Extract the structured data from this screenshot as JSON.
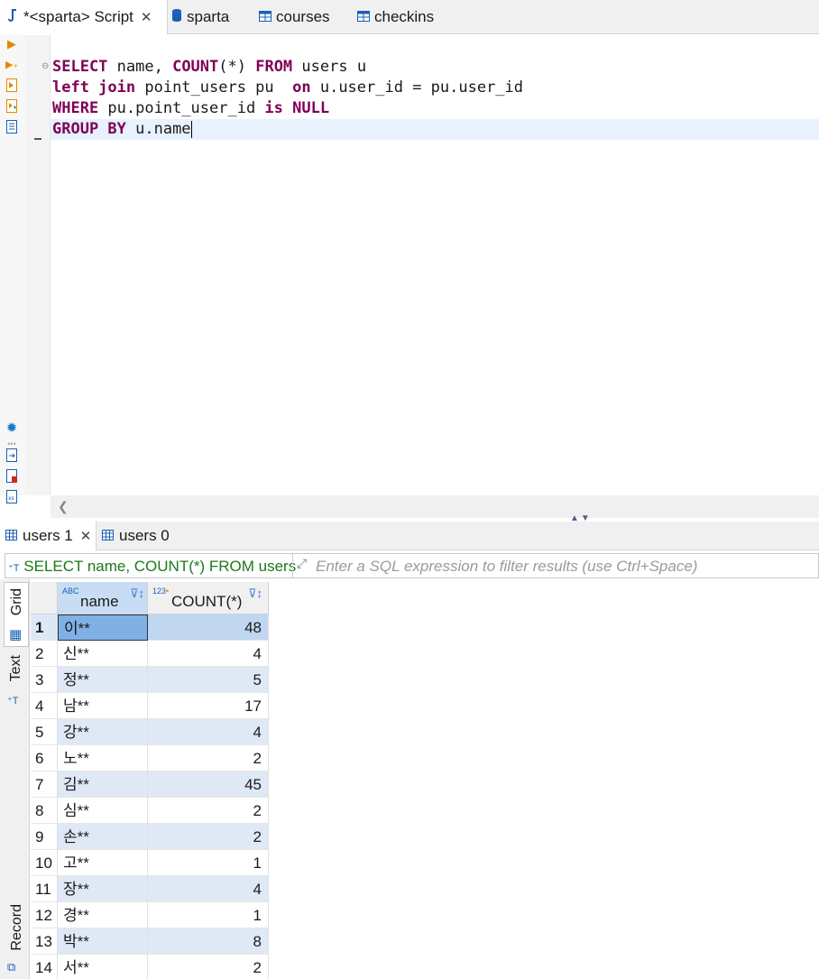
{
  "editor_tabs": [
    {
      "label": "*<sparta> Script",
      "icon": "sql-script-icon",
      "active": true
    },
    {
      "label": "sparta",
      "icon": "database-icon"
    },
    {
      "label": "courses",
      "icon": "table-icon"
    },
    {
      "label": "checkins",
      "icon": "table-icon"
    }
  ],
  "editor": {
    "lines": [
      [
        {
          "t": "SELECT",
          "k": true
        },
        {
          "t": " name, "
        },
        {
          "t": "COUNT",
          "k": true
        },
        {
          "t": "(*) "
        },
        {
          "t": "FROM",
          "k": true
        },
        {
          "t": " users u"
        }
      ],
      [
        {
          "t": "left join",
          "k": true
        },
        {
          "t": " point_users pu  "
        },
        {
          "t": "on",
          "k": true
        },
        {
          "t": " u.user_id = pu.user_id"
        }
      ],
      [
        {
          "t": "WHERE",
          "k": true
        },
        {
          "t": " pu.point_user_id "
        },
        {
          "t": "is",
          "k": true
        },
        {
          "t": " "
        },
        {
          "t": "NULL",
          "k": true
        }
      ],
      [
        {
          "t": "GROUP BY",
          "k": true
        },
        {
          "t": " u.name"
        }
      ]
    ]
  },
  "results": {
    "tabs": [
      {
        "label": "users 1",
        "active": true
      },
      {
        "label": "users 0"
      }
    ],
    "filter": {
      "query_label": "SELECT name, COUNT(*) FROM users",
      "placeholder": "Enter a SQL expression to filter results (use Ctrl+Space)"
    },
    "side_tabs": {
      "grid": "Grid",
      "text": "Text",
      "record": "Record"
    },
    "columns": [
      {
        "label": "name",
        "type_badge": "ABC"
      },
      {
        "label": "COUNT(*)",
        "type_badge": "123"
      }
    ],
    "rows": [
      {
        "n": "1",
        "name": "이**",
        "count": "48"
      },
      {
        "n": "2",
        "name": "신**",
        "count": "4"
      },
      {
        "n": "3",
        "name": "정**",
        "count": "5"
      },
      {
        "n": "4",
        "name": "남**",
        "count": "17"
      },
      {
        "n": "5",
        "name": "강**",
        "count": "4"
      },
      {
        "n": "6",
        "name": "노**",
        "count": "2"
      },
      {
        "n": "7",
        "name": "김**",
        "count": "45"
      },
      {
        "n": "8",
        "name": "심**",
        "count": "2"
      },
      {
        "n": "9",
        "name": "손**",
        "count": "2"
      },
      {
        "n": "10",
        "name": "고**",
        "count": "1"
      },
      {
        "n": "11",
        "name": "장**",
        "count": "4"
      },
      {
        "n": "12",
        "name": "경**",
        "count": "1"
      },
      {
        "n": "13",
        "name": "박**",
        "count": "8"
      },
      {
        "n": "14",
        "name": "서**",
        "count": "2"
      }
    ],
    "selected_row": 0
  },
  "colors": {
    "keyword": "#7f0055",
    "filter_query": "#1a7a1a",
    "selection": "#7fb0e6",
    "alt_row": "#dfe8f5"
  }
}
